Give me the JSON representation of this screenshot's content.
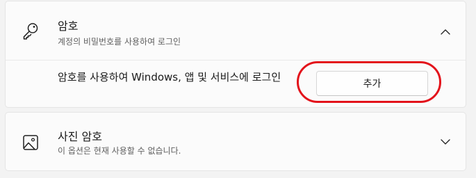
{
  "password_card": {
    "title": "암호",
    "subtitle": "계정의 비밀번호를 사용하여 로그인",
    "icon": "key-icon",
    "chevron": "chevron-up-icon",
    "expanded": true,
    "description": "암호를 사용하여 Windows, 앱 및 서비스에 로그인",
    "add_button_label": "추가"
  },
  "picture_password_card": {
    "title": "사진 암호",
    "subtitle": "이 옵션은 현재 사용할 수 없습니다.",
    "icon": "picture-icon",
    "chevron": "chevron-down-icon",
    "expanded": false
  },
  "annotation": {
    "highlight_color": "#e3131b",
    "target": "add_button"
  }
}
